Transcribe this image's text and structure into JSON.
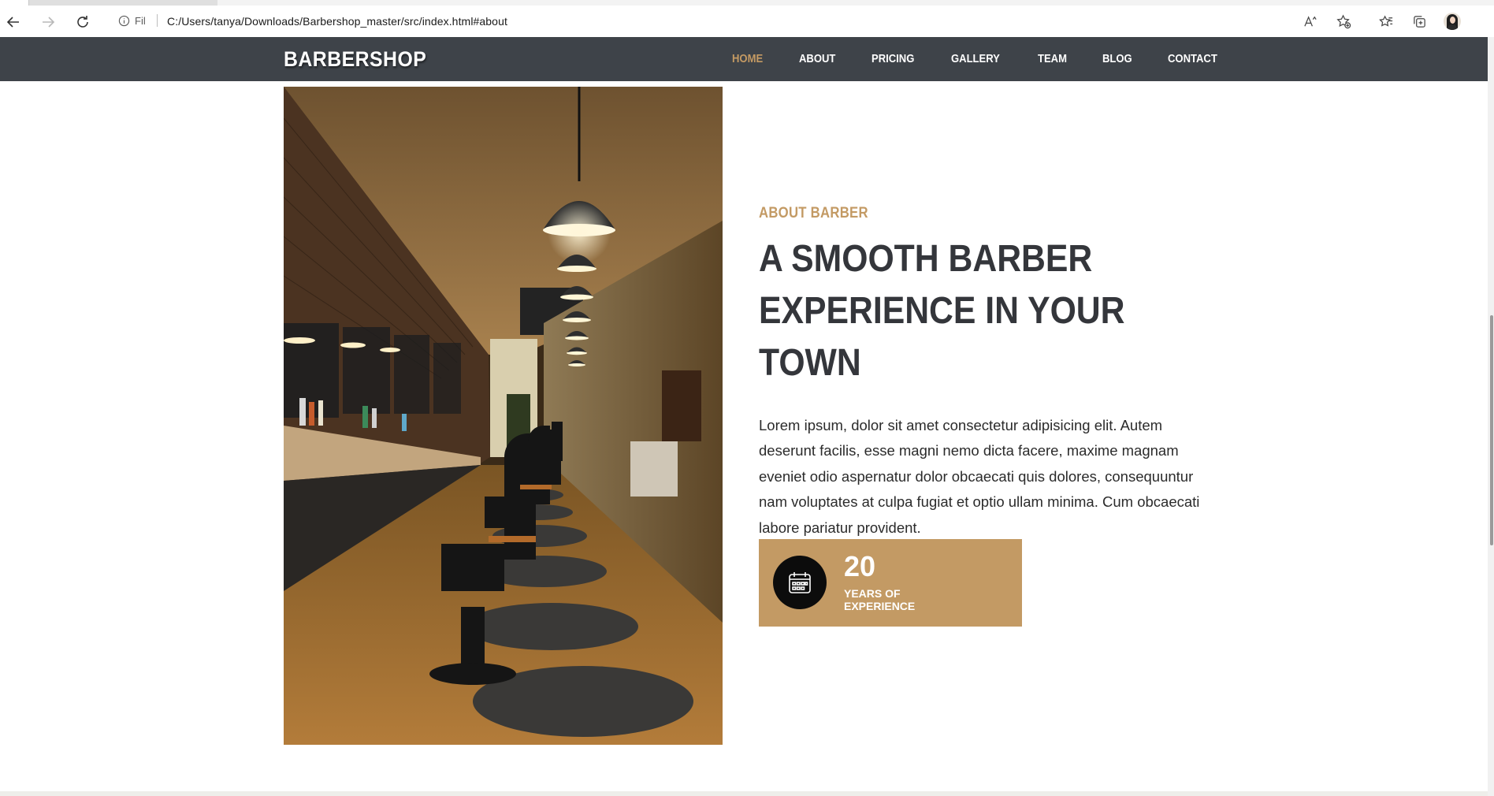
{
  "browser": {
    "site_info_label": "Fil",
    "url": "C:/Users/tanya/Downloads/Barbershop_master/src/index.html#about",
    "icons": [
      "back-icon",
      "forward-icon",
      "refresh-icon",
      "info-icon",
      "read-aloud-icon",
      "add-favorite-icon",
      "favorites-icon",
      "collections-icon",
      "profile-avatar"
    ]
  },
  "navbar": {
    "logo": "BARBERSHOP",
    "links": [
      {
        "label": "HOME",
        "active": true
      },
      {
        "label": "ABOUT",
        "active": false
      },
      {
        "label": "PRICING",
        "active": false
      },
      {
        "label": "GALLERY",
        "active": false
      },
      {
        "label": "TEAM",
        "active": false
      },
      {
        "label": "BLOG",
        "active": false
      },
      {
        "label": "CONTACT",
        "active": false
      }
    ]
  },
  "about": {
    "subtitle": "ABOUT BARBER",
    "headline": "A SMOOTH BARBER EXPERIENCE IN YOUR TOWN",
    "paragraph": "Lorem ipsum, dolor sit amet consectetur adipisicing elit. Autem deserunt facilis, esse magni nemo dicta facere, maxime magnam eveniet odio aspernatur dolor obcaecati quis dolores, consequuntur nam voluptates at culpa fugiat et optio ullam minima. Cum obcaecati labore pariatur provident.",
    "experience": {
      "number": "20",
      "label": "YEARS OF EXPERIENCE",
      "icon": "calendar-icon"
    }
  },
  "colors": {
    "accent": "#c39a64",
    "navbar_bg": "#3e4349",
    "heading": "#34363b"
  }
}
